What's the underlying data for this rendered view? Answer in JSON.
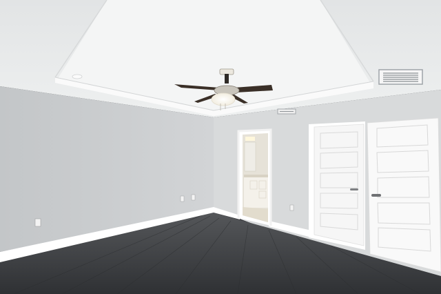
{
  "scene": {
    "colors": {
      "ceiling": "#e9ebec",
      "tray_ceiling": "#f3f4f4",
      "wall_left": "#c8cbcd",
      "wall_back": "#d9dbdc",
      "trim": "#ffffff",
      "floor": "#3f4144",
      "door": "#f7f7f7",
      "fan_blade": "#2e2520",
      "light": "#fffaf0",
      "vent": "#9ea3a8"
    },
    "icons": [
      "ceiling-fan-icon",
      "air-vent-icon",
      "door-handle-icon",
      "electrical-outlet-icon"
    ]
  }
}
